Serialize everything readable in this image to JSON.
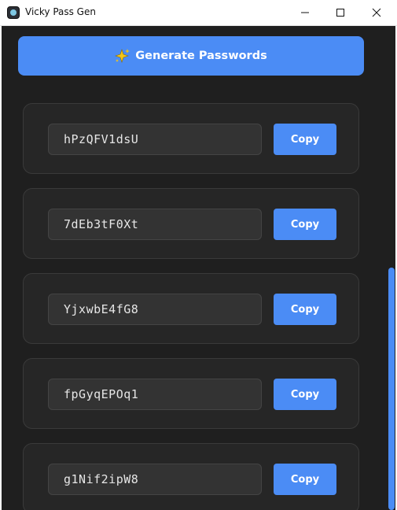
{
  "window": {
    "title": "Vicky Pass Gen",
    "app_icon": "app-logo-icon",
    "controls": [
      "minimize-icon",
      "maximize-icon",
      "close-icon"
    ]
  },
  "generate": {
    "label": "Generate Passwords",
    "icon": "sparkle-icon"
  },
  "passwords": [
    {
      "value": "hPzQFV1dsU",
      "copy_label": "Copy"
    },
    {
      "value": "7dEb3tF0Xt",
      "copy_label": "Copy"
    },
    {
      "value": "YjxwbE4fG8",
      "copy_label": "Copy"
    },
    {
      "value": "fpGyqEPOq1",
      "copy_label": "Copy"
    },
    {
      "value": "g1Nif2ipW8",
      "copy_label": "Copy"
    }
  ],
  "colors": {
    "accent": "#4b8cf5",
    "background": "#1f1f1f",
    "card": "#262626",
    "field": "#333333"
  }
}
